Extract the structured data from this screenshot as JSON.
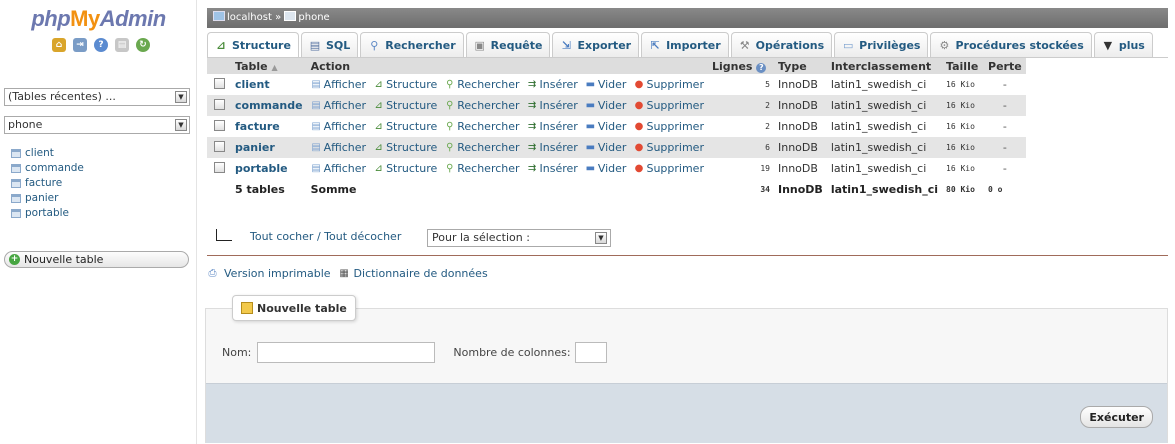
{
  "logo": {
    "php": "php",
    "my": "My",
    "admin": "Admin"
  },
  "nav": {
    "recent_tables": "(Tables récentes) ...",
    "db_select": "phone",
    "tables": [
      "client",
      "commande",
      "facture",
      "panier",
      "portable"
    ],
    "new_table": "Nouvelle table"
  },
  "breadcrumb": {
    "server": "localhost",
    "separator": "»",
    "db": "phone"
  },
  "tabs": [
    {
      "label": "Structure",
      "icon": "structure-icon"
    },
    {
      "label": "SQL",
      "icon": "sql-icon"
    },
    {
      "label": "Rechercher",
      "icon": "search-icon"
    },
    {
      "label": "Requête",
      "icon": "query-icon"
    },
    {
      "label": "Exporter",
      "icon": "export-icon"
    },
    {
      "label": "Importer",
      "icon": "import-icon"
    },
    {
      "label": "Opérations",
      "icon": "wrench-icon"
    },
    {
      "label": "Privilèges",
      "icon": "privileges-icon"
    },
    {
      "label": "Procédures stockées",
      "icon": "gears-icon"
    },
    {
      "label": "plus",
      "icon": "chevron-down-icon"
    }
  ],
  "table": {
    "headers": {
      "table": "Table",
      "action": "Action",
      "rows": "Lignes",
      "type": "Type",
      "collation": "Interclassement",
      "size": "Taille",
      "overhead": "Perte"
    },
    "actions": [
      "Afficher",
      "Structure",
      "Rechercher",
      "Insérer",
      "Vider",
      "Supprimer"
    ],
    "rows": [
      {
        "name": "client",
        "rows": "5",
        "type": "InnoDB",
        "collation": "latin1_swedish_ci",
        "size": "16 Kio",
        "overhead": "-"
      },
      {
        "name": "commande",
        "rows": "2",
        "type": "InnoDB",
        "collation": "latin1_swedish_ci",
        "size": "16 Kio",
        "overhead": "-"
      },
      {
        "name": "facture",
        "rows": "2",
        "type": "InnoDB",
        "collation": "latin1_swedish_ci",
        "size": "16 Kio",
        "overhead": "-"
      },
      {
        "name": "panier",
        "rows": "6",
        "type": "InnoDB",
        "collation": "latin1_swedish_ci",
        "size": "16 Kio",
        "overhead": "-"
      },
      {
        "name": "portable",
        "rows": "19",
        "type": "InnoDB",
        "collation": "latin1_swedish_ci",
        "size": "16 Kio",
        "overhead": "-"
      }
    ],
    "footer": {
      "count": "5 tables",
      "label": "Somme",
      "rows": "34",
      "type": "InnoDB",
      "collation": "latin1_swedish_ci",
      "size": "80 Kio",
      "overhead": "0 o"
    }
  },
  "bulk": {
    "check_all": "Tout cocher / Tout décocher",
    "select_placeholder": "Pour la sélection :"
  },
  "links": {
    "print": "Version imprimable",
    "dictionary": "Dictionnaire de données"
  },
  "create": {
    "legend": "Nouvelle table",
    "name_label": "Nom:",
    "cols_label": "Nombre de colonnes:",
    "submit": "Exécuter"
  }
}
